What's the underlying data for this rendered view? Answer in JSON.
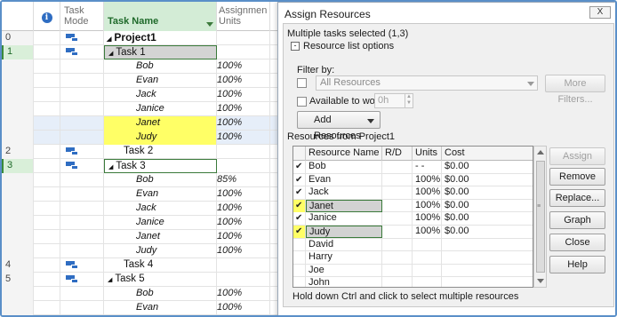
{
  "grid": {
    "headers": {
      "info_symbol": "i",
      "task_mode": "Task Mode",
      "task_name": "Task Name",
      "assignment_units": "Assignmen Units"
    },
    "rows": [
      {
        "id": "0",
        "name": "Project1",
        "units": "",
        "level": "summary0",
        "mode_icon": true,
        "triangle": true
      },
      {
        "id": "1",
        "name": "Task 1",
        "units": "",
        "level": "summary1",
        "mode_icon": true,
        "triangle": true,
        "selected": true,
        "boxed": true,
        "grey": true
      },
      {
        "id": "",
        "name": "Bob",
        "units": "100%",
        "level": "res"
      },
      {
        "id": "",
        "name": "Evan",
        "units": "100%",
        "level": "res"
      },
      {
        "id": "",
        "name": "Jack",
        "units": "100%",
        "level": "res"
      },
      {
        "id": "",
        "name": "Janice",
        "units": "100%",
        "level": "res"
      },
      {
        "id": "",
        "name": "Janet",
        "units": "100%",
        "level": "res",
        "yellow": true,
        "hl": true
      },
      {
        "id": "",
        "name": "Judy",
        "units": "100%",
        "level": "res",
        "yellow": true,
        "hl": true
      },
      {
        "id": "2",
        "name": "Task 2",
        "units": "",
        "level": "task",
        "mode_icon": true
      },
      {
        "id": "3",
        "name": "Task 3",
        "units": "",
        "level": "summary1",
        "mode_icon": true,
        "triangle": true,
        "selected": true,
        "boxed": true
      },
      {
        "id": "",
        "name": "Bob",
        "units": "85%",
        "level": "res"
      },
      {
        "id": "",
        "name": "Evan",
        "units": "100%",
        "level": "res"
      },
      {
        "id": "",
        "name": "Jack",
        "units": "100%",
        "level": "res"
      },
      {
        "id": "",
        "name": "Janice",
        "units": "100%",
        "level": "res"
      },
      {
        "id": "",
        "name": "Janet",
        "units": "100%",
        "level": "res"
      },
      {
        "id": "",
        "name": "Judy",
        "units": "100%",
        "level": "res"
      },
      {
        "id": "4",
        "name": "Task 4",
        "units": "",
        "level": "task",
        "mode_icon": true
      },
      {
        "id": "5",
        "name": "Task 5",
        "units": "",
        "level": "summary1",
        "mode_icon": true,
        "triangle": true
      },
      {
        "id": "",
        "name": "Bob",
        "units": "100%",
        "level": "res"
      },
      {
        "id": "",
        "name": "Evan",
        "units": "100%",
        "level": "res"
      }
    ]
  },
  "dialog": {
    "title": "Assign Resources",
    "close_label": "X",
    "selection_text": "Multiple tasks selected (1,3)",
    "collapse_symbol": "-",
    "options_label": "Resource list options",
    "filter_label": "Filter by:",
    "filter_value": "All Resources",
    "more_filters": "More Filters...",
    "available_label": "Available to work",
    "available_value": "0h",
    "add_resources": "Add Resources",
    "resources_from": "Resources from Project1",
    "columns": [
      "Resource Name",
      "R/D",
      "Units",
      "Cost"
    ],
    "resources": [
      {
        "check": "✔",
        "name": "Bob",
        "rd": "",
        "units": "- -",
        "cost": "$0.00",
        "yellow": false
      },
      {
        "check": "✔",
        "name": "Evan",
        "rd": "",
        "units": "100%",
        "cost": "$0.00",
        "yellow": false
      },
      {
        "check": "✔",
        "name": "Jack",
        "rd": "",
        "units": "100%",
        "cost": "$0.00",
        "yellow": false
      },
      {
        "check": "✔",
        "name": "Janet",
        "rd": "",
        "units": "100%",
        "cost": "$0.00",
        "yellow": true
      },
      {
        "check": "✔",
        "name": "Janice",
        "rd": "",
        "units": "100%",
        "cost": "$0.00",
        "yellow": false
      },
      {
        "check": "✔",
        "name": "Judy",
        "rd": "",
        "units": "100%",
        "cost": "$0.00",
        "yellow": true
      },
      {
        "check": "",
        "name": "David",
        "rd": "",
        "units": "",
        "cost": "",
        "yellow": false
      },
      {
        "check": "",
        "name": "Harry",
        "rd": "",
        "units": "",
        "cost": "",
        "yellow": false
      },
      {
        "check": "",
        "name": "Joe",
        "rd": "",
        "units": "",
        "cost": "",
        "yellow": false
      },
      {
        "check": "",
        "name": "John",
        "rd": "",
        "units": "",
        "cost": "",
        "yellow": false
      }
    ],
    "buttons": {
      "assign": "Assign",
      "remove": "Remove",
      "replace": "Replace...",
      "graph": "Graph",
      "close": "Close",
      "help": "Help"
    },
    "hint": "Hold down Ctrl and click to select multiple resources"
  },
  "colors": {
    "selection_yellow": "#ffff66",
    "header_green": "#d3ecd6",
    "frame_blue": "#5a8fc8",
    "icon_blue": "#2f6dc2"
  }
}
